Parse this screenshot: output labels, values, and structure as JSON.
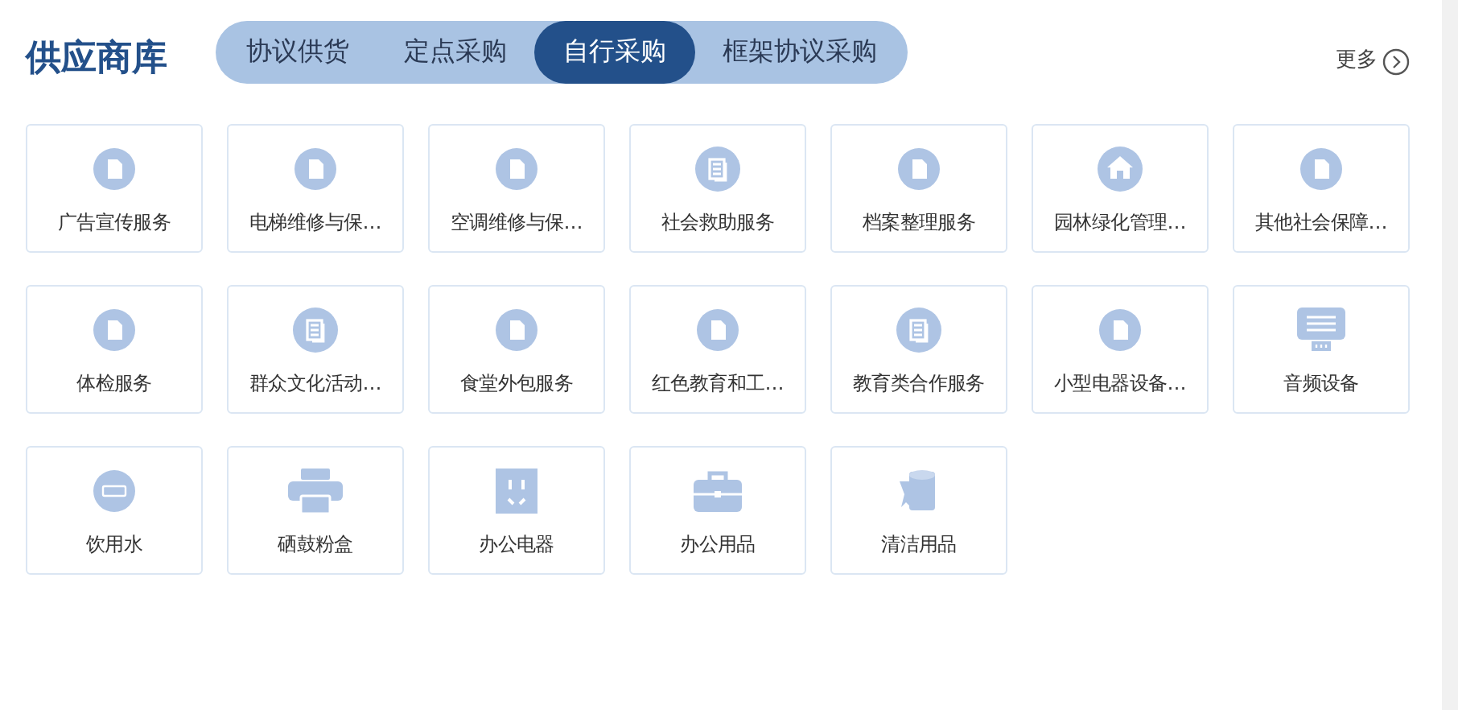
{
  "title": "供应商库",
  "tabs": [
    {
      "label": "协议供货",
      "selected": false
    },
    {
      "label": "定点采购",
      "selected": false
    },
    {
      "label": "自行采购",
      "selected": true
    },
    {
      "label": "框架协议采购",
      "selected": false
    }
  ],
  "more": "更多",
  "items": [
    {
      "label": "广告宣传服务",
      "kind": "doc"
    },
    {
      "label": "电梯维修与保…",
      "kind": "doc"
    },
    {
      "label": "空调维修与保…",
      "kind": "doc"
    },
    {
      "label": "社会救助服务",
      "kind": "list"
    },
    {
      "label": "档案整理服务",
      "kind": "doc"
    },
    {
      "label": "园林绿化管理…",
      "kind": "home"
    },
    {
      "label": "其他社会保障…",
      "kind": "doc"
    },
    {
      "label": "体检服务",
      "kind": "doc"
    },
    {
      "label": "群众文化活动…",
      "kind": "list"
    },
    {
      "label": "食堂外包服务",
      "kind": "doc"
    },
    {
      "label": "红色教育和工…",
      "kind": "doc"
    },
    {
      "label": "教育类合作服务",
      "kind": "list"
    },
    {
      "label": "小型电器设备…",
      "kind": "doc"
    },
    {
      "label": "音频设备",
      "kind": "audio"
    },
    {
      "label": "饮用水",
      "kind": "led"
    },
    {
      "label": "硒鼓粉盒",
      "kind": "printer"
    },
    {
      "label": "办公电器",
      "kind": "socket"
    },
    {
      "label": "办公用品",
      "kind": "briefcase"
    },
    {
      "label": "清洁用品",
      "kind": "roll"
    }
  ]
}
